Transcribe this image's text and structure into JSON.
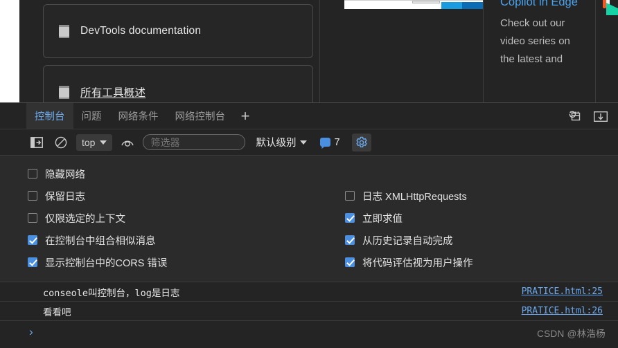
{
  "page": {
    "doc_cards": [
      {
        "icon": "book-icon",
        "label": "DevTools documentation"
      },
      {
        "icon": "book-icon",
        "label": "所有工具概述"
      }
    ],
    "promo": {
      "title": "Copilot in Edge",
      "body": "Check out our video series on the latest and"
    }
  },
  "devtools": {
    "tabs": [
      {
        "label": "控制台",
        "active": true
      },
      {
        "label": "问题",
        "active": false
      },
      {
        "label": "网络条件",
        "active": false
      },
      {
        "label": "网络控制台",
        "active": false
      }
    ],
    "add_tab_label": "+",
    "tabbar_icons": [
      {
        "name": "dock-side-icon"
      },
      {
        "name": "customize-devtools-icon"
      }
    ],
    "toolbar": {
      "sidebar_toggle_icon": "console-sidebar-icon",
      "clear_console_icon": "clear-console-icon",
      "context_selector": "top",
      "live_expression_icon": "eye-icon",
      "filter_placeholder": "筛选器",
      "filter_value": "",
      "level_selector": "默认级别",
      "message_count": "7",
      "settings_icon": "gear-icon"
    },
    "settings": {
      "left_column": [
        {
          "label": "隐藏网络",
          "checked": false
        },
        {
          "label": "保留日志",
          "checked": false
        },
        {
          "label": "仅限选定的上下文",
          "checked": false
        },
        {
          "label": "在控制台中组合相似消息",
          "checked": true
        },
        {
          "label": "显示控制台中的CORS 错误",
          "checked": true
        }
      ],
      "right_column": [
        {
          "label": "日志 XMLHttpRequests",
          "checked": false
        },
        {
          "label": "立即求值",
          "checked": true
        },
        {
          "label": "从历史记录自动完成",
          "checked": true
        },
        {
          "label": "将代码评估视为用户操作",
          "checked": true
        }
      ]
    },
    "messages": [
      {
        "text": "conseole叫控制台，log是日志",
        "source": "PRATICE.html:25"
      },
      {
        "text": "看看吧",
        "source": "PRATICE.html:26"
      }
    ],
    "prompt_symbol": "›"
  },
  "watermark": "CSDN @林浩杨",
  "colors": {
    "accent_blue": "#4b8fe0",
    "link_blue": "#6aa9f0",
    "panel_bg": "#242424",
    "settings_bg": "#2b2b2b"
  }
}
